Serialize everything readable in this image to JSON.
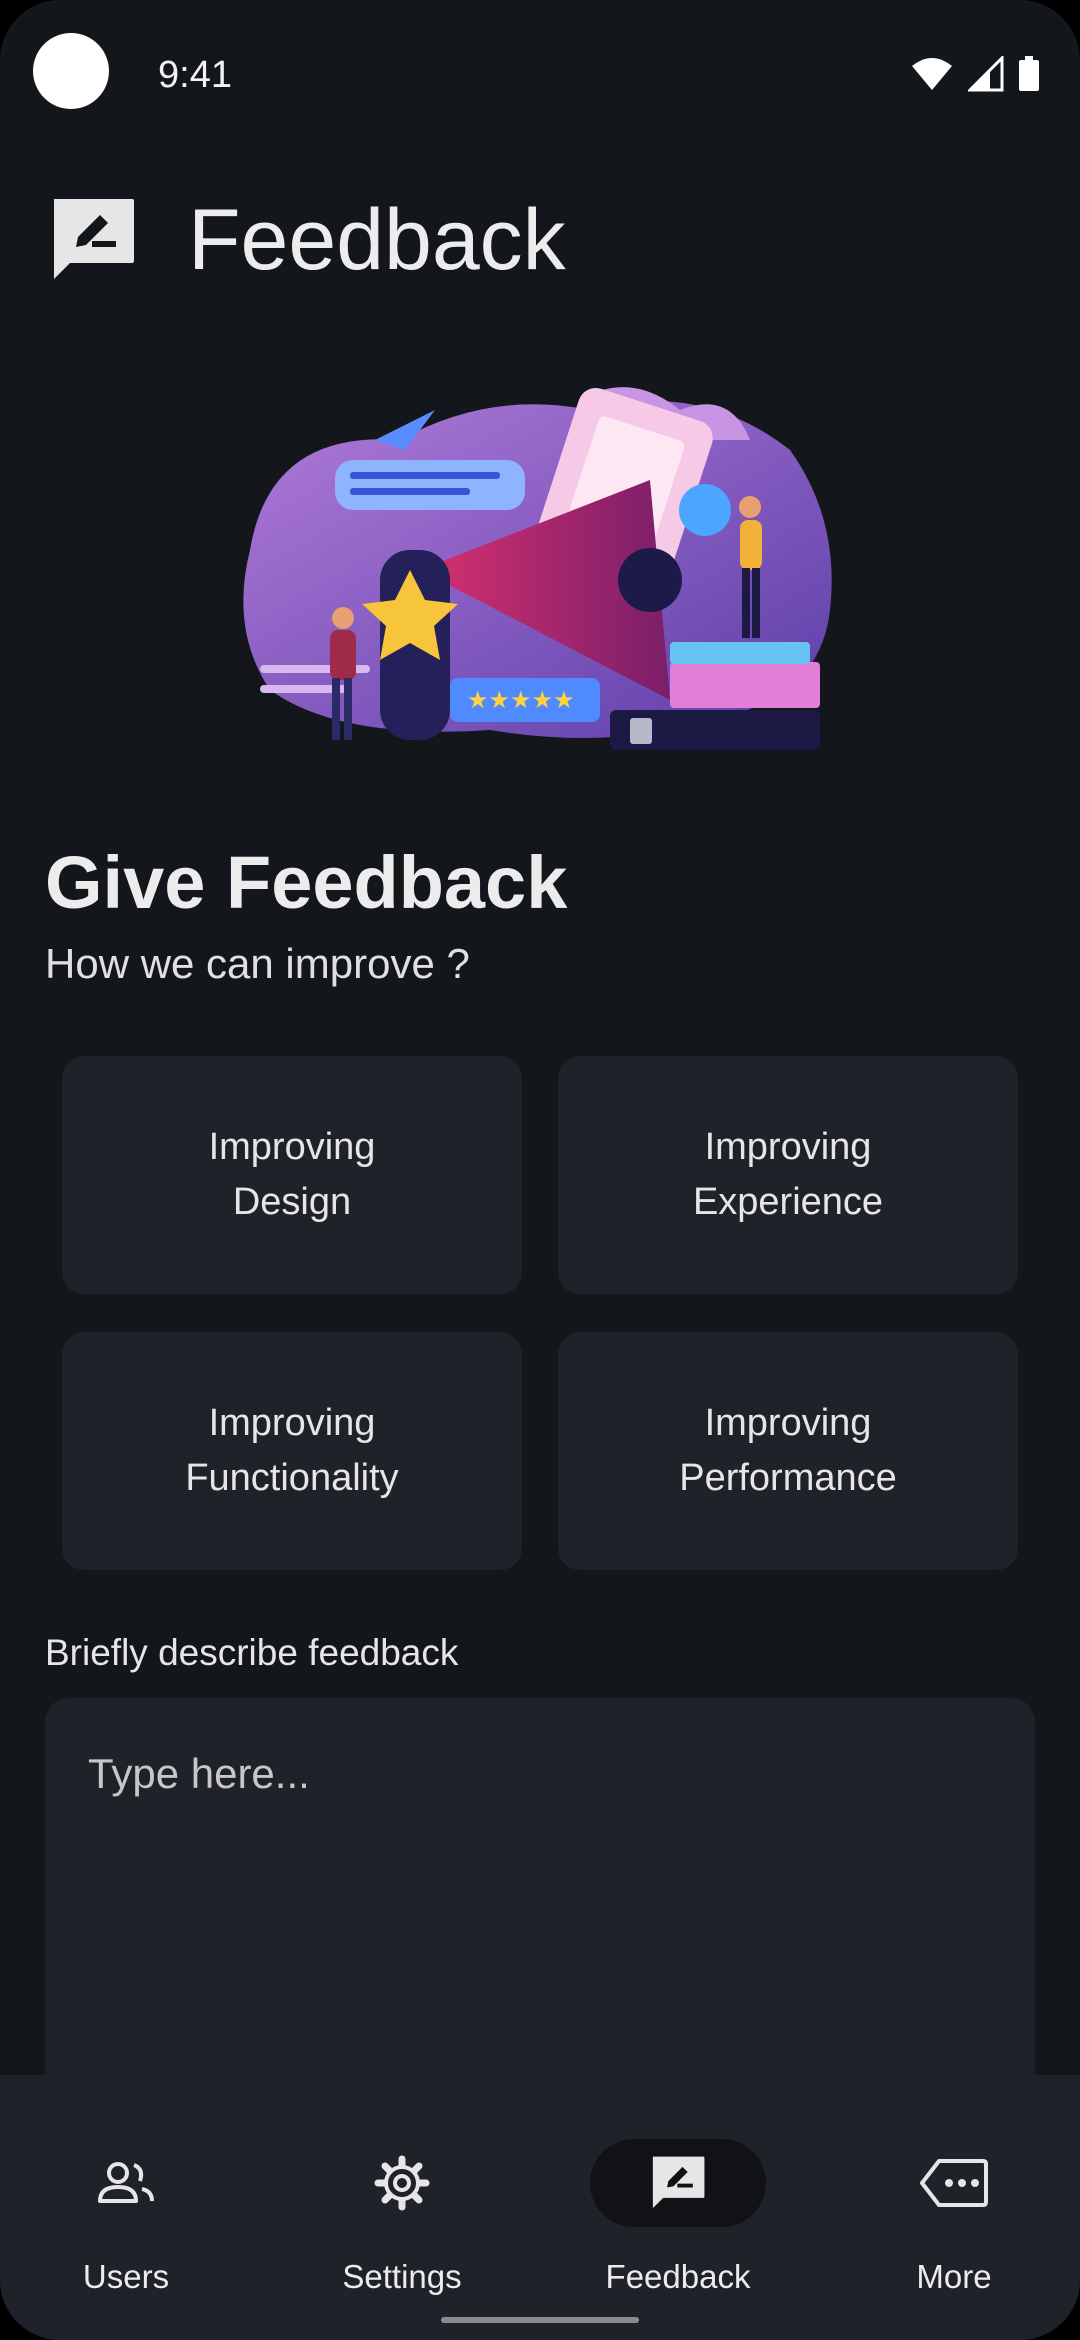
{
  "status_bar": {
    "time": "9:41"
  },
  "app_bar": {
    "title": "Feedback",
    "icon": "feedback-edit-icon"
  },
  "hero": {
    "illustration": "feedback-megaphone-illustration"
  },
  "section": {
    "title": "Give Feedback",
    "subtitle": "How we can improve ?"
  },
  "options": [
    {
      "label": "Improving\nDesign"
    },
    {
      "label": "Improving\nExperience"
    },
    {
      "label": "Improving\nFunctionality"
    },
    {
      "label": "Improving\nPerformance"
    }
  ],
  "feedback_field": {
    "label": "Briefly describe feedback",
    "placeholder": "Type here..."
  },
  "bottom_nav": {
    "active": "Feedback",
    "items": [
      {
        "label": "Users",
        "icon": "users-icon"
      },
      {
        "label": "Settings",
        "icon": "settings-gear-icon"
      },
      {
        "label": "Feedback",
        "icon": "feedback-icon"
      },
      {
        "label": "More",
        "icon": "more-icon"
      }
    ]
  },
  "colors": {
    "background": "#13161b",
    "surface": "#1f2228",
    "active_pill": "#101216",
    "text": "#e6e6e6"
  }
}
